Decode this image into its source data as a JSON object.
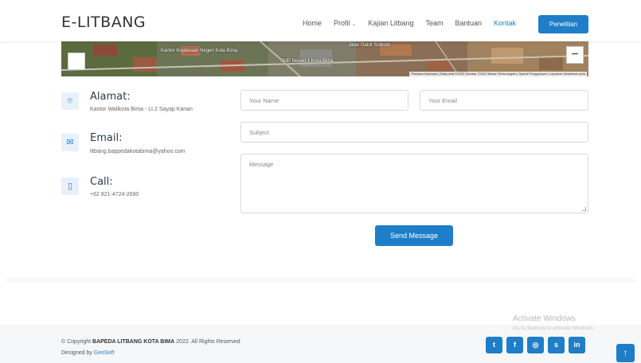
{
  "header": {
    "logo": "E-LITBANG",
    "nav": [
      {
        "label": "Home",
        "dropdown": false,
        "active": false
      },
      {
        "label": "Profil",
        "dropdown": true,
        "active": false
      },
      {
        "label": "Kajian Litbang",
        "dropdown": false,
        "active": false
      },
      {
        "label": "Team",
        "dropdown": false,
        "active": false
      },
      {
        "label": "Bantuan",
        "dropdown": false,
        "active": false
      },
      {
        "label": "Kontak",
        "dropdown": false,
        "active": true
      }
    ],
    "cta_label": "Penelitian"
  },
  "map": {
    "labels": [
      "Kantor Kejaksaan Negeri Kota Bima",
      "Jalan Gatot Subroto",
      "SMP Negeri 1 Kota Bima"
    ],
    "attribution": "Pintasan keyboard | Data peta ©2022 Gambar ©2022 Maxar Technologies | Syarat Penggunaan | Laporkan kesalahan peta",
    "zoom_out": "−"
  },
  "contact": {
    "address": {
      "title": "Alamat:",
      "text": "Kantor Walikota Bima - Lt.2 Sayap Kanan",
      "icon": "map-marker-icon"
    },
    "email": {
      "title": "Email:",
      "text": "litbang.bappedakotabima@yahoo.com",
      "icon": "envelope-icon"
    },
    "call": {
      "title": "Call:",
      "text": "+62 821-4724-2690",
      "icon": "phone-icon"
    }
  },
  "form": {
    "name_placeholder": "Your Name",
    "email_placeholder": "Your Email",
    "subject_placeholder": "Subject",
    "message_placeholder": "Message",
    "send_label": "Send Message"
  },
  "footer": {
    "copyright_prefix": "© Copyright",
    "copyright_org": "BAPEDA LITBANG KOTA BIMA",
    "copyright_suffix": "2022. All Rights Reserved",
    "designed_prefix": "Designed by",
    "designed_by": "GeoSoft",
    "social": [
      {
        "name": "twitter-icon",
        "glyph": "t"
      },
      {
        "name": "facebook-icon",
        "glyph": "f"
      },
      {
        "name": "instagram-icon",
        "glyph": "◎"
      },
      {
        "name": "skype-icon",
        "glyph": "s"
      },
      {
        "name": "linkedin-icon",
        "glyph": "in"
      }
    ],
    "totop_glyph": "↑"
  },
  "watermark": {
    "line1": "Activate Windows",
    "line2": "Go to Settings to activate Windows."
  },
  "colors": {
    "accent": "#1e7ec8",
    "icon_bg": "#e8f1fa"
  }
}
